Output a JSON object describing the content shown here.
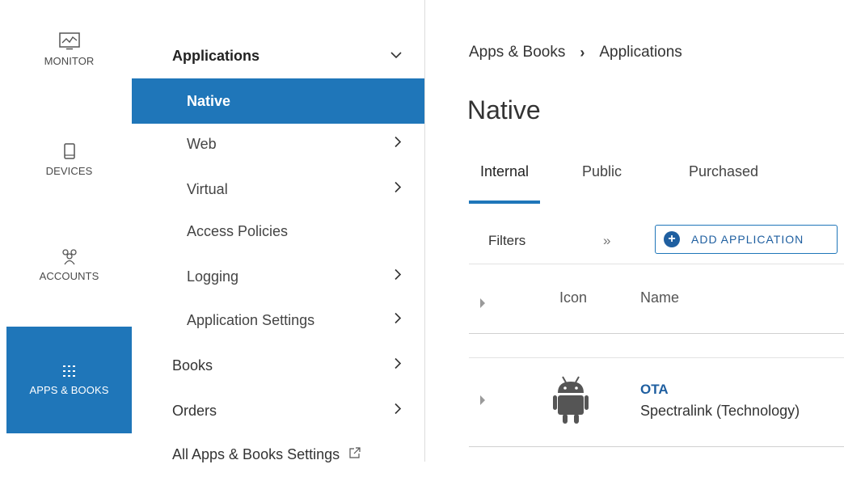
{
  "rail": {
    "items": [
      {
        "label": "MONITOR",
        "icon": "monitor-icon",
        "active": false
      },
      {
        "label": "DEVICES",
        "icon": "device-icon",
        "active": false
      },
      {
        "label": "ACCOUNTS",
        "icon": "accounts-icon",
        "active": false
      },
      {
        "label": "APPS & BOOKS",
        "icon": "apps-grid-icon",
        "active": true
      }
    ]
  },
  "subnav": {
    "items": [
      {
        "label": "Applications",
        "chevron": "⌄",
        "level": 1
      },
      {
        "label": "Native",
        "chevron": "",
        "level": 2
      },
      {
        "label": "Web",
        "chevron": "›",
        "level": 2
      },
      {
        "label": "Virtual",
        "chevron": "›",
        "level": 2
      },
      {
        "label": "Access Policies",
        "chevron": "",
        "level": 2
      },
      {
        "label": "Logging",
        "chevron": "›",
        "level": 2
      },
      {
        "label": "Application Settings",
        "chevron": "›",
        "level": 2
      },
      {
        "label": "Books",
        "chevron": "›",
        "level": 1
      },
      {
        "label": "Orders",
        "chevron": "›",
        "level": 1
      },
      {
        "label": "All Apps & Books Settings",
        "chevron": "",
        "level": 1
      }
    ]
  },
  "breadcrumb": {
    "root": "Apps & Books",
    "separator": "›",
    "current": "Applications"
  },
  "page_title": "Native",
  "tabs": [
    {
      "label": "Internal",
      "active": true
    },
    {
      "label": "Public",
      "active": false
    },
    {
      "label": "Purchased",
      "active": false
    }
  ],
  "toolbar": {
    "filters_label": "Filters",
    "collapse_label": "»",
    "add_button_label": "ADD APPLICATION"
  },
  "table": {
    "columns": [
      "Icon",
      "Name"
    ],
    "rows": [
      {
        "name": "OTA",
        "organization": "Spectralink (Technology)",
        "platform_icon": "android-icon"
      }
    ]
  },
  "colors": {
    "accent": "#1f76b9",
    "link": "#1f5fa0"
  }
}
